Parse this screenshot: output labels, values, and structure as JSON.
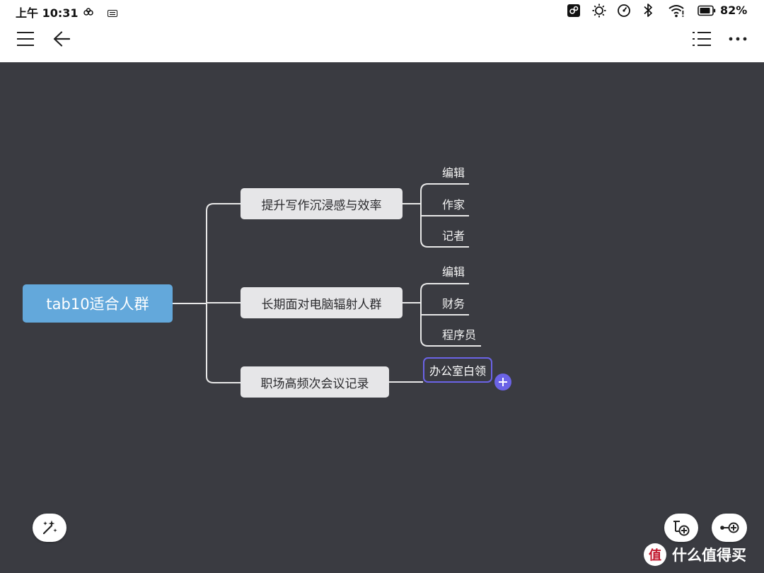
{
  "status_bar": {
    "time": "上午 10:31",
    "battery": "82%",
    "left_icons": [
      "cloud-sync-icon",
      "keyboard-icon"
    ],
    "right_icons": [
      "screen-cast-icon",
      "brightness-icon",
      "dial-icon",
      "bluetooth-icon",
      "wifi-icon",
      "battery-icon"
    ]
  },
  "toolbar": {
    "left_icons": [
      "menu-icon",
      "back-arrow-icon"
    ],
    "right_icons": [
      "outline-list-icon",
      "more-icon"
    ]
  },
  "mindmap": {
    "root": "tab10适合人群",
    "branches": [
      {
        "label": "提升写作沉浸感与效率",
        "children": [
          "编辑",
          "作家",
          "记者"
        ]
      },
      {
        "label": "长期面对电脑辐射人群",
        "children": [
          "编辑",
          "财务",
          "程序员"
        ]
      },
      {
        "label": "职场高频次会议记录",
        "children": [
          "办公室白领"
        ]
      }
    ],
    "selected_node": "办公室白领",
    "colors": {
      "canvas": "#3a3b41",
      "root": "#63a8db",
      "branch": "#e6e6e8",
      "connector": "#e8e8e8",
      "selection": "#6b63e6"
    }
  },
  "fabs": {
    "magic": "magic-wand-icon",
    "add_subtopic": "add-subtopic-icon",
    "add_sibling": "add-topic-icon"
  },
  "watermark": {
    "badge": "值",
    "text": "什么值得买"
  }
}
